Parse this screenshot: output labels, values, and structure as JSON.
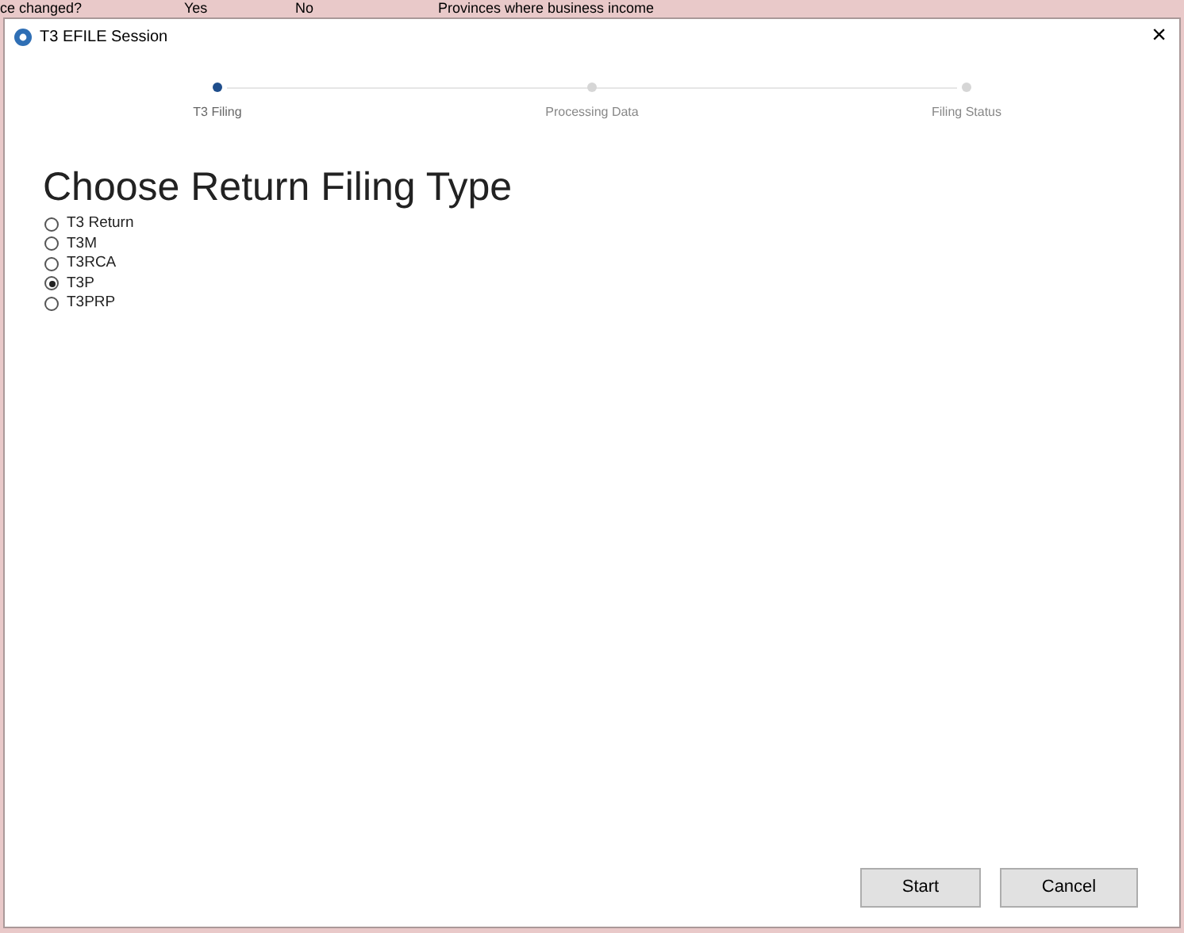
{
  "background": {
    "top_texts": [
      "ce changed?",
      "Yes",
      "No",
      "Provinces where business income"
    ]
  },
  "window": {
    "title": "T3 EFILE Session",
    "close": "×"
  },
  "steps": [
    {
      "label": "T3 Filing",
      "selected": true
    },
    {
      "label": "Processing Data",
      "selected": false
    },
    {
      "label": "Filing Status",
      "selected": false
    }
  ],
  "heading": "Choose Return Filing Type",
  "options": [
    {
      "label": "T3 Return",
      "selected": false
    },
    {
      "label": "T3M",
      "selected": false
    },
    {
      "label": "T3RCA",
      "selected": false
    },
    {
      "label": "T3P",
      "selected": true
    },
    {
      "label": "T3PRP",
      "selected": false
    }
  ],
  "buttons": [
    "Start",
    "Cancel"
  ]
}
